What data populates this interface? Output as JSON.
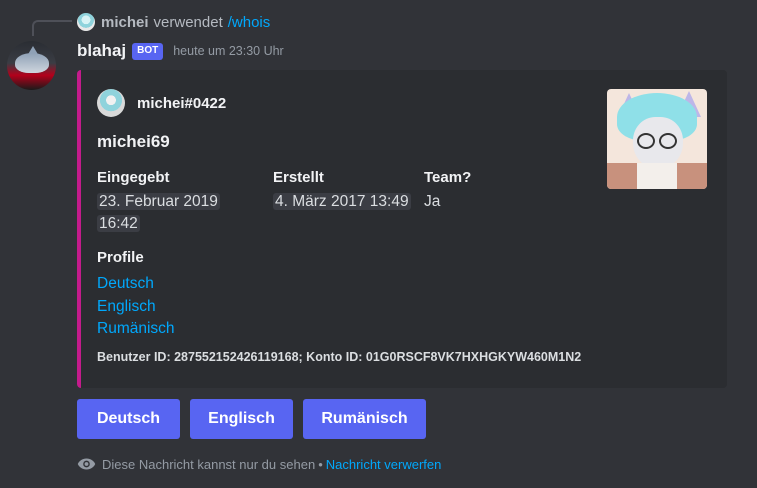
{
  "reply": {
    "user": "michei",
    "text": "verwendet",
    "command": "/whois"
  },
  "message": {
    "username": "blahaj",
    "badge": "BOT",
    "timestamp": "heute um 23:30 Uhr"
  },
  "embed": {
    "accent_color": "#c41b8c",
    "author": "michei#0422",
    "title": "michei69",
    "fields": [
      {
        "name": "Eingegebt",
        "value": "23. Februar 2019 16:42"
      },
      {
        "name": "Erstellt",
        "value": "4. März 2017 13:49"
      },
      {
        "name": "Team?",
        "value": "Ja"
      }
    ],
    "profile": {
      "name": "Profile",
      "links": [
        "Deutsch",
        "Englisch",
        "Rumänisch"
      ]
    },
    "footer": "Benutzer ID: 287552152426119168; Konto ID: 01G0RSCF8VK7HXHGKYW460M1N2"
  },
  "buttons": [
    "Deutsch",
    "Englisch",
    "Rumänisch"
  ],
  "button_color": "#5865f2",
  "ephemeral": {
    "icon": "eye-icon",
    "text": "Diese Nachricht kannst nur du sehen",
    "separator": "•",
    "link": "Nachricht verwerfen"
  }
}
